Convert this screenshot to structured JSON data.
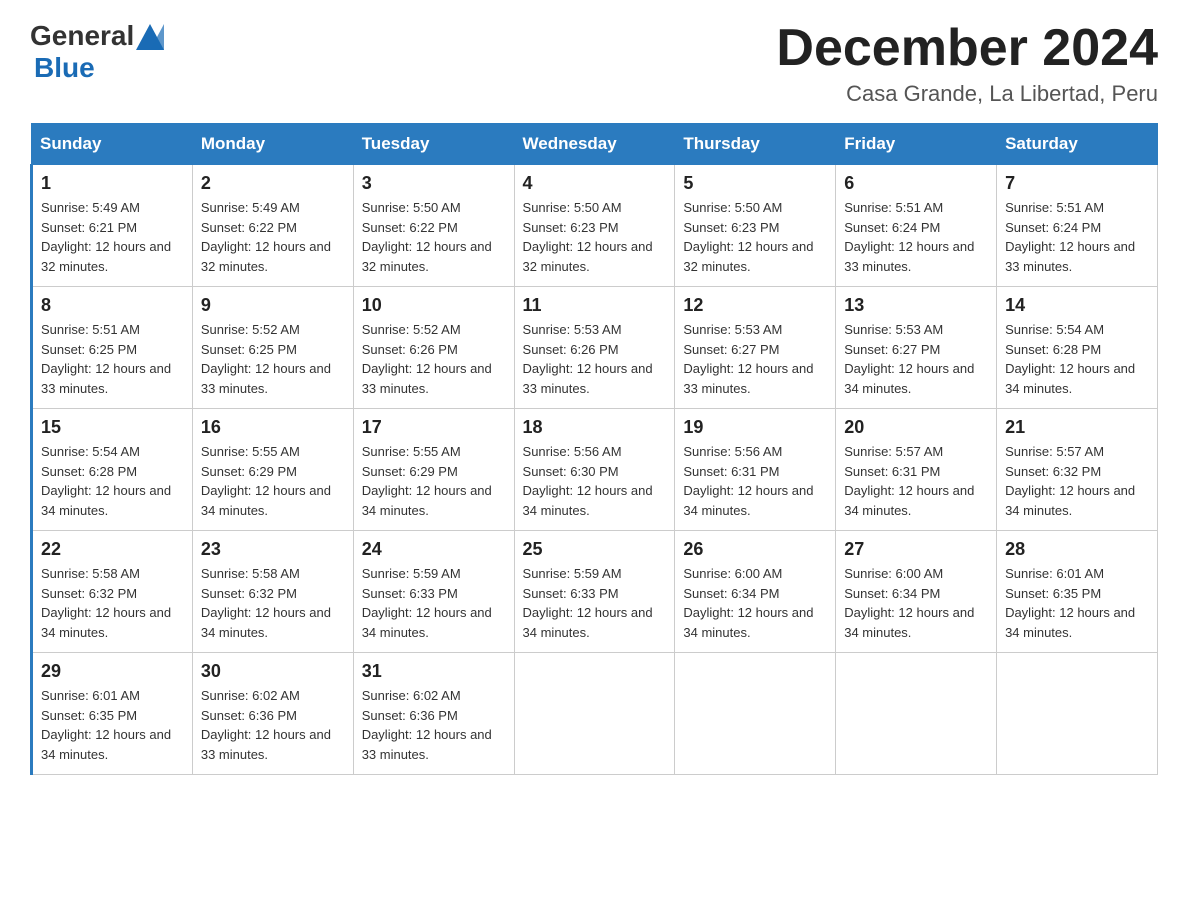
{
  "header": {
    "logo_general": "General",
    "logo_blue": "Blue",
    "title": "December 2024",
    "subtitle": "Casa Grande, La Libertad, Peru"
  },
  "weekdays": [
    "Sunday",
    "Monday",
    "Tuesday",
    "Wednesday",
    "Thursday",
    "Friday",
    "Saturday"
  ],
  "weeks": [
    [
      {
        "day": "1",
        "sunrise": "5:49 AM",
        "sunset": "6:21 PM",
        "daylight": "12 hours and 32 minutes."
      },
      {
        "day": "2",
        "sunrise": "5:49 AM",
        "sunset": "6:22 PM",
        "daylight": "12 hours and 32 minutes."
      },
      {
        "day": "3",
        "sunrise": "5:50 AM",
        "sunset": "6:22 PM",
        "daylight": "12 hours and 32 minutes."
      },
      {
        "day": "4",
        "sunrise": "5:50 AM",
        "sunset": "6:23 PM",
        "daylight": "12 hours and 32 minutes."
      },
      {
        "day": "5",
        "sunrise": "5:50 AM",
        "sunset": "6:23 PM",
        "daylight": "12 hours and 32 minutes."
      },
      {
        "day": "6",
        "sunrise": "5:51 AM",
        "sunset": "6:24 PM",
        "daylight": "12 hours and 33 minutes."
      },
      {
        "day": "7",
        "sunrise": "5:51 AM",
        "sunset": "6:24 PM",
        "daylight": "12 hours and 33 minutes."
      }
    ],
    [
      {
        "day": "8",
        "sunrise": "5:51 AM",
        "sunset": "6:25 PM",
        "daylight": "12 hours and 33 minutes."
      },
      {
        "day": "9",
        "sunrise": "5:52 AM",
        "sunset": "6:25 PM",
        "daylight": "12 hours and 33 minutes."
      },
      {
        "day": "10",
        "sunrise": "5:52 AM",
        "sunset": "6:26 PM",
        "daylight": "12 hours and 33 minutes."
      },
      {
        "day": "11",
        "sunrise": "5:53 AM",
        "sunset": "6:26 PM",
        "daylight": "12 hours and 33 minutes."
      },
      {
        "day": "12",
        "sunrise": "5:53 AM",
        "sunset": "6:27 PM",
        "daylight": "12 hours and 33 minutes."
      },
      {
        "day": "13",
        "sunrise": "5:53 AM",
        "sunset": "6:27 PM",
        "daylight": "12 hours and 34 minutes."
      },
      {
        "day": "14",
        "sunrise": "5:54 AM",
        "sunset": "6:28 PM",
        "daylight": "12 hours and 34 minutes."
      }
    ],
    [
      {
        "day": "15",
        "sunrise": "5:54 AM",
        "sunset": "6:28 PM",
        "daylight": "12 hours and 34 minutes."
      },
      {
        "day": "16",
        "sunrise": "5:55 AM",
        "sunset": "6:29 PM",
        "daylight": "12 hours and 34 minutes."
      },
      {
        "day": "17",
        "sunrise": "5:55 AM",
        "sunset": "6:29 PM",
        "daylight": "12 hours and 34 minutes."
      },
      {
        "day": "18",
        "sunrise": "5:56 AM",
        "sunset": "6:30 PM",
        "daylight": "12 hours and 34 minutes."
      },
      {
        "day": "19",
        "sunrise": "5:56 AM",
        "sunset": "6:31 PM",
        "daylight": "12 hours and 34 minutes."
      },
      {
        "day": "20",
        "sunrise": "5:57 AM",
        "sunset": "6:31 PM",
        "daylight": "12 hours and 34 minutes."
      },
      {
        "day": "21",
        "sunrise": "5:57 AM",
        "sunset": "6:32 PM",
        "daylight": "12 hours and 34 minutes."
      }
    ],
    [
      {
        "day": "22",
        "sunrise": "5:58 AM",
        "sunset": "6:32 PM",
        "daylight": "12 hours and 34 minutes."
      },
      {
        "day": "23",
        "sunrise": "5:58 AM",
        "sunset": "6:32 PM",
        "daylight": "12 hours and 34 minutes."
      },
      {
        "day": "24",
        "sunrise": "5:59 AM",
        "sunset": "6:33 PM",
        "daylight": "12 hours and 34 minutes."
      },
      {
        "day": "25",
        "sunrise": "5:59 AM",
        "sunset": "6:33 PM",
        "daylight": "12 hours and 34 minutes."
      },
      {
        "day": "26",
        "sunrise": "6:00 AM",
        "sunset": "6:34 PM",
        "daylight": "12 hours and 34 minutes."
      },
      {
        "day": "27",
        "sunrise": "6:00 AM",
        "sunset": "6:34 PM",
        "daylight": "12 hours and 34 minutes."
      },
      {
        "day": "28",
        "sunrise": "6:01 AM",
        "sunset": "6:35 PM",
        "daylight": "12 hours and 34 minutes."
      }
    ],
    [
      {
        "day": "29",
        "sunrise": "6:01 AM",
        "sunset": "6:35 PM",
        "daylight": "12 hours and 34 minutes."
      },
      {
        "day": "30",
        "sunrise": "6:02 AM",
        "sunset": "6:36 PM",
        "daylight": "12 hours and 33 minutes."
      },
      {
        "day": "31",
        "sunrise": "6:02 AM",
        "sunset": "6:36 PM",
        "daylight": "12 hours and 33 minutes."
      },
      null,
      null,
      null,
      null
    ]
  ]
}
